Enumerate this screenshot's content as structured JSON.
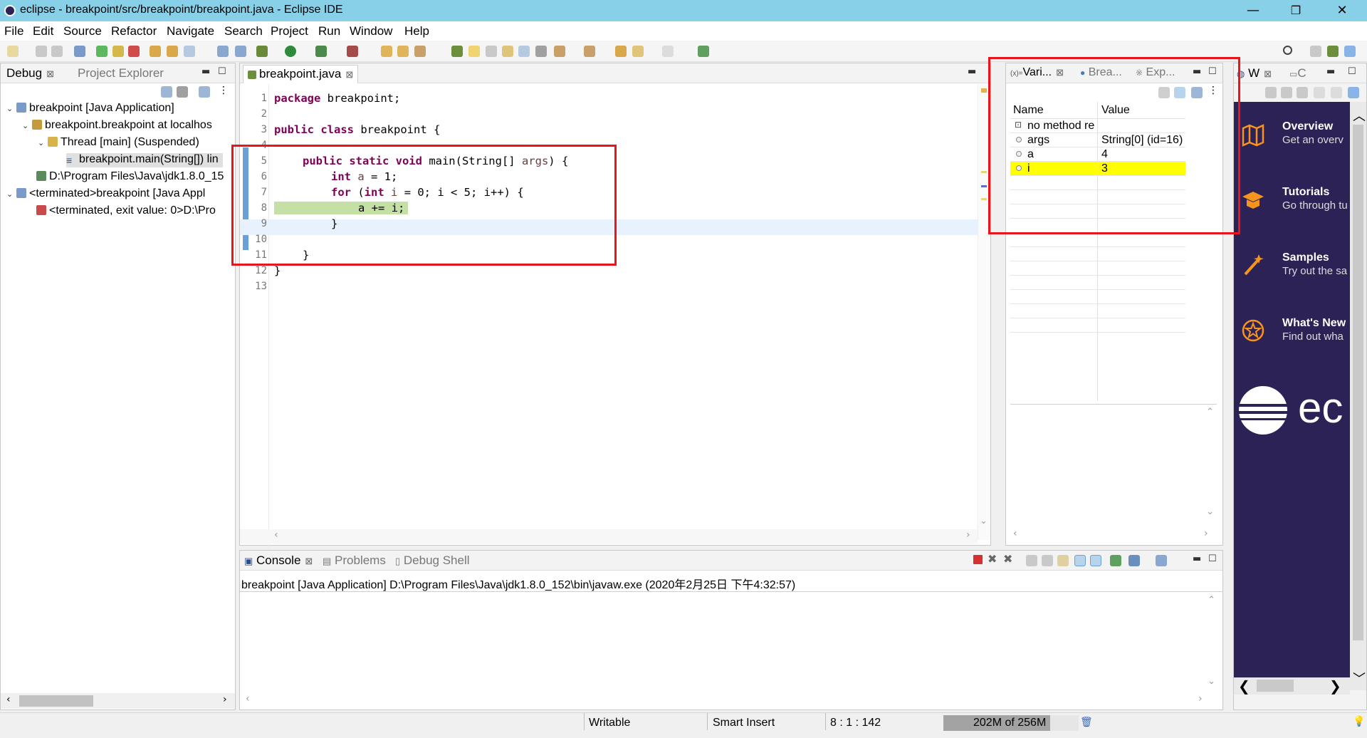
{
  "window": {
    "title": "eclipse - breakpoint/src/breakpoint/breakpoint.java - Eclipse IDE",
    "minimize": "—",
    "maximize": "❐",
    "close": "✕"
  },
  "menu": [
    "File",
    "Edit",
    "Source",
    "Refactor",
    "Navigate",
    "Search",
    "Project",
    "Run",
    "Window",
    "Help"
  ],
  "debug_panel": {
    "tabs": [
      "Debug",
      "Project Explorer"
    ],
    "tree": [
      "breakpoint [Java Application]",
      "breakpoint.breakpoint at localhos",
      "Thread [main] (Suspended)",
      "breakpoint.main(String[]) lin",
      "D:\\Program Files\\Java\\jdk1.8.0_15",
      "<terminated>breakpoint [Java Appl",
      "<terminated, exit value: 0>D:\\Pro"
    ]
  },
  "editor": {
    "tab": "breakpoint.java",
    "lines": [
      "1",
      "2",
      "3",
      "4",
      "5",
      "6",
      "7",
      "8",
      "9",
      "10",
      "11",
      "12",
      "13"
    ],
    "code": {
      "l1_kw": "package",
      "l1_rest": " breakpoint;",
      "l3_kw1": "public",
      "l3_kw2": "class",
      "l3_rest": " breakpoint {",
      "l5_kw": "public static void",
      "l5_a": " main(String[] ",
      "l5_var": "args",
      "l5_b": ") {",
      "l6_kw": "int",
      "l6_var": "a",
      "l6_rest": " = 1;",
      "l7_kw": "for",
      "l7_a": " (",
      "l7_kw2": "int",
      "l7_var": "i",
      "l7_rest": " = 0; i < 5; i++) {",
      "l8": "a += i;",
      "l9": "}",
      "l11": "}",
      "l12": "}"
    }
  },
  "variables_panel": {
    "tabs": [
      "Vari...",
      "Brea...",
      "Exp..."
    ],
    "headers": [
      "Name",
      "Value"
    ],
    "rows": [
      {
        "name": "no method re",
        "value": ""
      },
      {
        "name": "args",
        "value": "String[0]  (id=16)"
      },
      {
        "name": "a",
        "value": "4"
      },
      {
        "name": "i",
        "value": "3"
      }
    ]
  },
  "welcome_panel": {
    "tabs": [
      "W",
      "C"
    ],
    "items": [
      {
        "title": "Overview",
        "subtitle": "Get an overv"
      },
      {
        "title": "Tutorials",
        "subtitle": "Go through tu"
      },
      {
        "title": "Samples",
        "subtitle": "Try out the sa"
      },
      {
        "title": "What's New",
        "subtitle": "Find out wha"
      }
    ],
    "logo_text": "ec"
  },
  "console_panel": {
    "tabs": [
      "Console",
      "Problems",
      "Debug Shell"
    ],
    "output": "breakpoint [Java Application] D:\\Program Files\\Java\\jdk1.8.0_152\\bin\\javaw.exe (2020年2月25日 下午4:32:57)"
  },
  "status": {
    "writable": "Writable",
    "insert_mode": "Smart Insert",
    "position": "8 : 1 : 142",
    "memory": "202M of 256M",
    "memory_used_fraction": 0.79
  },
  "colors": {
    "accent_red": "#e8151b",
    "highlight_yellow": "#ffff00",
    "current_line": "#c5e0a5",
    "welcome_bg": "#2c2255"
  }
}
